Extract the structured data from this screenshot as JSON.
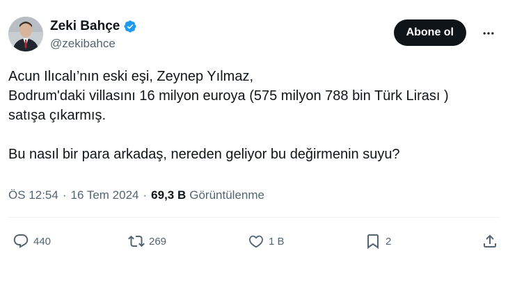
{
  "author": {
    "name": "Zeki Bahçe",
    "handle": "@zekibahce",
    "verified": true
  },
  "follow_label": "Abone ol",
  "more_label": "···",
  "tweet": {
    "line1": "Acun Ilıcalı’nın eski eşi, Zeynep Yılmaz,",
    "line2": "Bodrum'daki villasını 16 milyon euroya (575 milyon 788 bin Türk Lirası )",
    "line3": "satışa çıkarmış.",
    "line4": "Bu nasıl bir para arkadaş, nereden geliyor bu değirmenin suyu?"
  },
  "meta": {
    "time": "ÖS 12:54",
    "date": "16 Tem 2024",
    "views_count": "69,3 B",
    "views_label": "Görüntülenme"
  },
  "actions": {
    "replies": "440",
    "reposts": "269",
    "likes": "1 B",
    "bookmarks": "2"
  },
  "colors": {
    "text": "#0f1419",
    "secondary": "#536471",
    "verified": "#1d9bf0",
    "button_bg": "#0f1419"
  },
  "icons": [
    "verified-badge-icon",
    "more-icon",
    "reply-icon",
    "repost-icon",
    "like-icon",
    "bookmark-icon",
    "share-icon"
  ]
}
